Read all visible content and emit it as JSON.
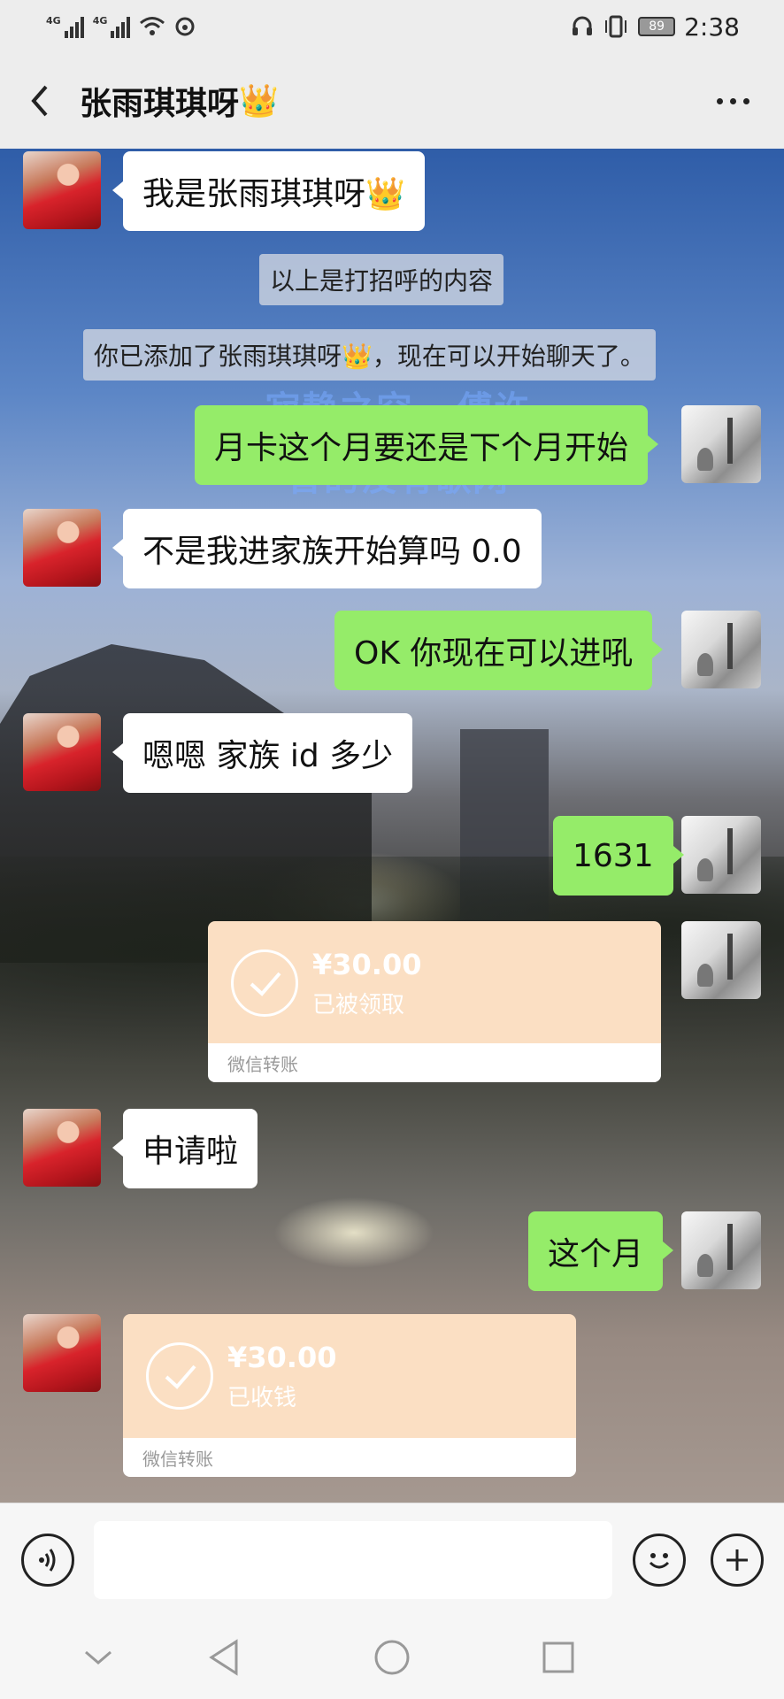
{
  "status_bar": {
    "signal1_tag": "4G",
    "signal2_tag": "4G",
    "battery": "89",
    "time": "2:38"
  },
  "header": {
    "title": "张雨琪琪呀",
    "title_emoji": "👑"
  },
  "watermark": {
    "line1": "寂静之空 · 傅许",
    "line2": "曾的没有歌网"
  },
  "messages": [
    {
      "side": "left",
      "type": "text",
      "text": "我是张雨琪琪呀👑"
    },
    {
      "side": "system",
      "type": "system",
      "text": "以上是打招呼的内容"
    },
    {
      "side": "system",
      "type": "system",
      "text": "你已添加了张雨琪琪呀👑，现在可以开始聊天了。"
    },
    {
      "side": "right",
      "type": "text",
      "text": "月卡这个月要还是下个月开始"
    },
    {
      "side": "left",
      "type": "text",
      "text": "不是我进家族开始算吗 0.0"
    },
    {
      "side": "right",
      "type": "text",
      "text": "OK  你现在可以进吼"
    },
    {
      "side": "left",
      "type": "text",
      "text": "嗯嗯 家族 id 多少"
    },
    {
      "side": "right",
      "type": "text",
      "text": "1631"
    },
    {
      "side": "right",
      "type": "transfer",
      "amount": "¥30.00",
      "status": "已被领取",
      "footer": "微信转账"
    },
    {
      "side": "left",
      "type": "text",
      "text": "申请啦"
    },
    {
      "side": "right",
      "type": "text",
      "text": "这个月"
    },
    {
      "side": "left",
      "type": "transfer",
      "amount": "¥30.00",
      "status": "已收钱",
      "footer": "微信转账"
    }
  ],
  "input_bar": {
    "voice_icon": "voice-icon",
    "emoji_icon": "emoji-icon",
    "plus_icon": "plus-icon"
  },
  "colors": {
    "my_bubble": "#95ec69",
    "their_bubble": "#ffffff",
    "transfer_bg": "#fbdfc3",
    "bar_bg": "#ededed"
  }
}
